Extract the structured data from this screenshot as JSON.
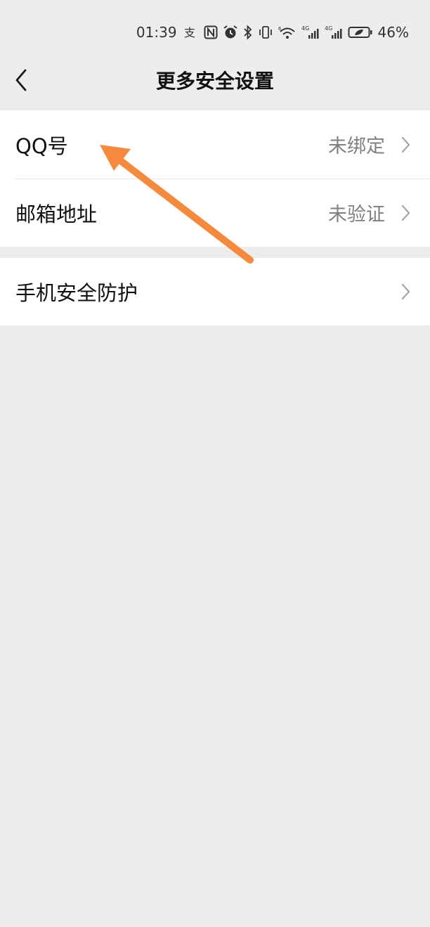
{
  "status_bar": {
    "time": "01:39",
    "battery_percent": "46%",
    "icons": [
      "alipay-icon",
      "nfc-icon",
      "alarm-icon",
      "bluetooth-icon",
      "vibrate-icon",
      "wifi-icon",
      "signal-4g-icon",
      "signal-4g-icon",
      "battery-icon"
    ]
  },
  "nav": {
    "title": "更多安全设置",
    "back_icon": "chevron-left-icon"
  },
  "settings": {
    "items": [
      {
        "label": "QQ号",
        "value": "未绑定"
      },
      {
        "label": "邮箱地址",
        "value": "未验证"
      },
      {
        "label": "手机安全防护",
        "value": ""
      }
    ]
  },
  "colors": {
    "background": "#ededed",
    "card": "#ffffff",
    "secondary_text": "#7f7f7f",
    "annotation_arrow": "#f58a3c"
  }
}
